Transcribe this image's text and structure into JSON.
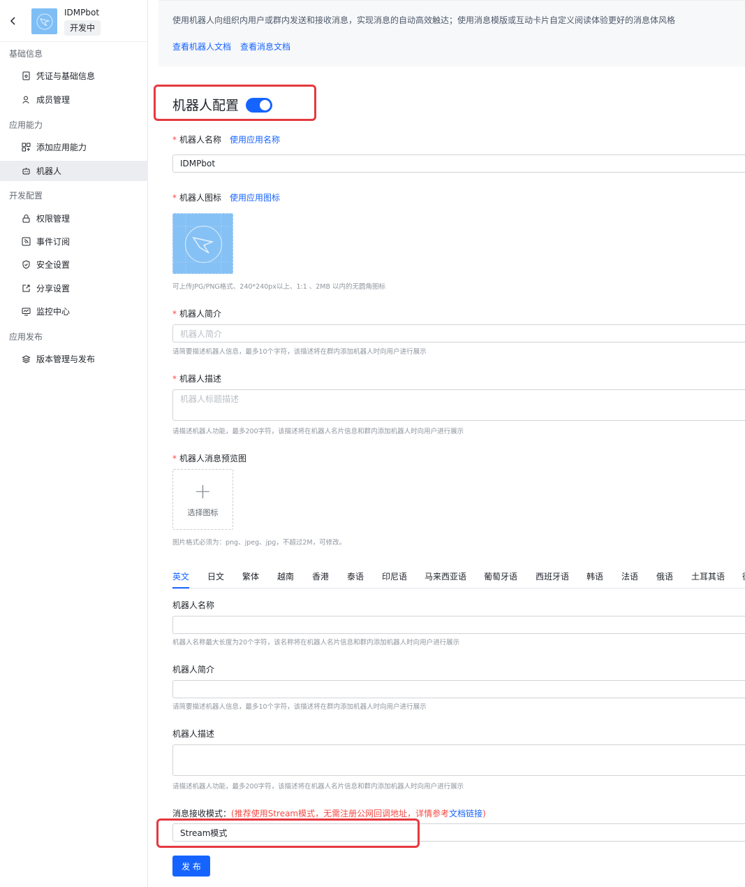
{
  "app": {
    "name": "IDMPbot",
    "status": "开发中"
  },
  "sidebar": {
    "groups": [
      {
        "title": "基础信息",
        "items": [
          {
            "label": "凭证与基础信息",
            "icon": "credential-icon"
          },
          {
            "label": "成员管理",
            "icon": "user-icon"
          }
        ]
      },
      {
        "title": "应用能力",
        "items": [
          {
            "label": "添加应用能力",
            "icon": "apps-icon"
          },
          {
            "label": "机器人",
            "icon": "robot-icon",
            "active": true
          }
        ]
      },
      {
        "title": "开发配置",
        "items": [
          {
            "label": "权限管理",
            "icon": "lock-icon"
          },
          {
            "label": "事件订阅",
            "icon": "rss-icon"
          },
          {
            "label": "安全设置",
            "icon": "shield-icon"
          },
          {
            "label": "分享设置",
            "icon": "share-icon"
          },
          {
            "label": "监控中心",
            "icon": "monitor-icon"
          }
        ]
      },
      {
        "title": "应用发布",
        "items": [
          {
            "label": "版本管理与发布",
            "icon": "layers-icon"
          }
        ]
      }
    ]
  },
  "intro": {
    "description": "使用机器人向组织内用户或群内发送和接收消息，实现消息的自动高效触达；使用消息模版或互动卡片自定义阅读体验更好的消息体风格",
    "links": [
      "查看机器人文档",
      "查看消息文档"
    ]
  },
  "config": {
    "title": "机器人配置",
    "enabled": true,
    "name": {
      "label": "机器人名称",
      "link": "使用应用名称",
      "value": "IDMPbot"
    },
    "icon": {
      "label": "机器人图标",
      "link": "使用应用图标",
      "hint": "可上传JPG/PNG格式、240*240px以上、1:1 、2MB 以内的无圆角图标"
    },
    "intro": {
      "label": "机器人简介",
      "placeholder": "机器人简介",
      "hint": "请简要描述机器人信息，最多10个字符，该描述将在群内添加机器人时向用户进行展示"
    },
    "desc": {
      "label": "机器人描述",
      "placeholder": "机器人标题描述",
      "hint": "请描述机器人功能，最多200字符，该描述将在机器人名片信息和群内添加机器人时向用户进行展示"
    },
    "preview": {
      "label": "机器人消息预览图",
      "upload": "选择图标",
      "hint": "图片格式必须为：png、jpeg、jpg，不超过2M，可修改。"
    }
  },
  "lang_tabs": [
    "英文",
    "日文",
    "繁体",
    "越南",
    "香港",
    "泰语",
    "印尼语",
    "马来西亚语",
    "葡萄牙语",
    "西班牙语",
    "韩语",
    "法语",
    "俄语",
    "土耳其语",
    "德"
  ],
  "lang_form": {
    "name": {
      "label": "机器人名称",
      "hint": "机器人名称最大长度为20个字符，该名称将在机器人名片信息和群内添加机器人时向用户进行展示"
    },
    "intro": {
      "label": "机器人简介",
      "hint": "请简要描述机器人信息，最多10个字符，该描述将在群内添加机器人时向用户进行展示"
    },
    "desc": {
      "label": "机器人描述",
      "hint": "请描述机器人功能，最多200字符，该描述将在机器人名片信息和群内添加机器人时向用户进行展示"
    }
  },
  "mode": {
    "label": "消息接收模式：",
    "note_open": "(",
    "note": "推荐使用Stream模式，无需注册公网回调地址，详情参考",
    "note_link": "文档链接",
    "note_close": ")",
    "value": "Stream模式"
  },
  "publish_label": "发 布",
  "colors": {
    "accent": "#1664ff",
    "highlight": "#e5393f",
    "required": "#f54a45"
  }
}
